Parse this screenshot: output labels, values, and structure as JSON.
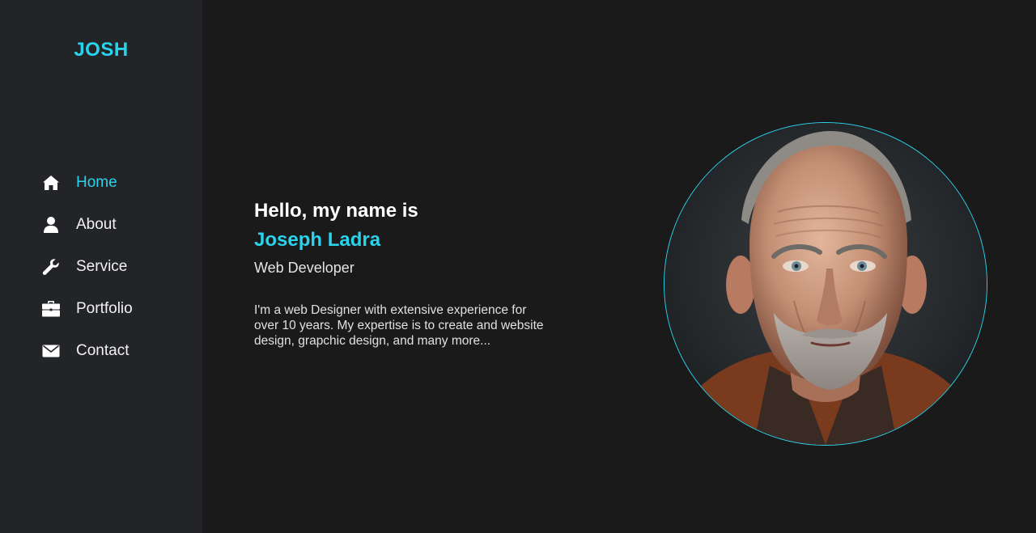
{
  "brand": {
    "logo_text": "JOSH",
    "accent_color": "#2ad3ec"
  },
  "sidebar": {
    "items": [
      {
        "label": "Home",
        "icon": "home-icon",
        "active": true
      },
      {
        "label": "About",
        "icon": "user-icon",
        "active": false
      },
      {
        "label": "Service",
        "icon": "wrench-icon",
        "active": false
      },
      {
        "label": "Portfolio",
        "icon": "briefcase-icon",
        "active": false
      },
      {
        "label": "Contact",
        "icon": "envelope-icon",
        "active": false
      }
    ]
  },
  "hero": {
    "greeting": "Hello, my name is",
    "name": "Joseph Ladra",
    "role": "Web Developer",
    "bio": "I'm a web Designer with extensive experience for over 10 years. My expertise is to create and website design, grapchic design, and many more..."
  },
  "colors": {
    "sidebar_bg": "#222428",
    "main_bg": "#1a1a1a",
    "accent": "#2ad3ec"
  }
}
